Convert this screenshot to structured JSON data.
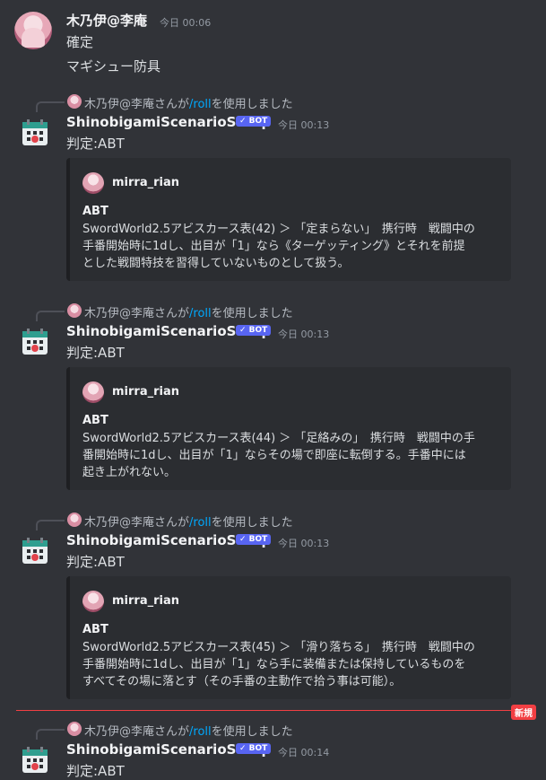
{
  "first_message": {
    "username": "木乃伊@李庵",
    "timestamp": "今日 00:06",
    "lines": [
      "確定",
      "マギシュー防具"
    ]
  },
  "bot": {
    "name": "ShinobigamiScenarioSetup",
    "badge": "✓ BOT"
  },
  "interactions": [
    {
      "reply": {
        "user": "木乃伊@李庵さんが",
        "command": "/roll",
        "suffix": "を使用しました"
      },
      "timestamp": "今日 00:13",
      "text": "判定:ABT",
      "embed": {
        "author": "mirra_rian",
        "title": "ABT",
        "lines": [
          "SwordWorld2.5アビスカース表(42) ＞ 「定まらない」　携行時　戦闘中の",
          "手番開始時に1dし、出目が「1」なら《ターゲッティング》とそれを前提",
          "とした戦闘特技を習得していないものとして扱う。"
        ]
      }
    },
    {
      "reply": {
        "user": "木乃伊@李庵さんが",
        "command": "/roll",
        "suffix": "を使用しました"
      },
      "timestamp": "今日 00:13",
      "text": "判定:ABT",
      "embed": {
        "author": "mirra_rian",
        "title": "ABT",
        "lines": [
          "SwordWorld2.5アビスカース表(44) ＞ 「足絡みの」　携行時　戦闘中の手",
          "番開始時に1dし、出目が「1」ならその場で即座に転倒する。手番中には",
          "起き上がれない。"
        ]
      }
    },
    {
      "reply": {
        "user": "木乃伊@李庵さんが",
        "command": "/roll",
        "suffix": "を使用しました"
      },
      "timestamp": "今日 00:13",
      "text": "判定:ABT",
      "embed": {
        "author": "mirra_rian",
        "title": "ABT",
        "lines": [
          "SwordWorld2.5アビスカース表(45) ＞ 「滑り落ちる」　携行時　戦闘中の",
          "手番開始時に1dし、出目が「1」なら手に装備または保持しているものを",
          "すべてその場に落とす（その手番の主動作で拾う事は可能）。"
        ]
      }
    },
    {
      "reply": {
        "user": "木乃伊@李庵さんが",
        "command": "/roll",
        "suffix": "を使用しました"
      },
      "timestamp": "今日 00:14",
      "text": "判定:ABT"
    }
  ],
  "new_label": "新規",
  "colors": {
    "accent": "#5865f2",
    "new": "#f23f43",
    "link": "#00a8fc"
  }
}
